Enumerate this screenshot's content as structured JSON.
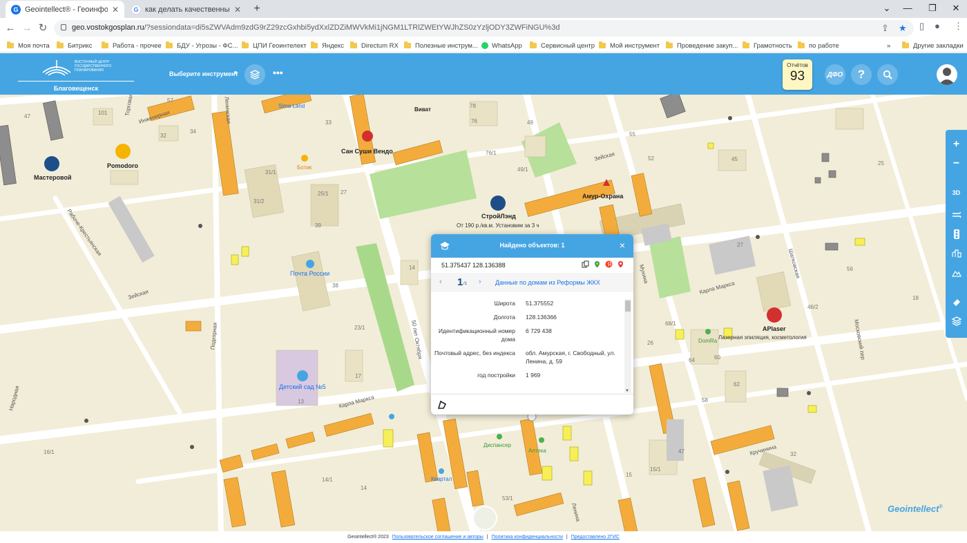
{
  "browser": {
    "tabs": [
      {
        "title": "Geointellect® - Геоинформаци",
        "active": true
      },
      {
        "title": "как делать качественные сним",
        "active": false
      }
    ],
    "new_tab": "+",
    "url_host": "geo.vostokgosplan.ru",
    "url_rest": "/?sessiondata=di5sZWVAdm9zdG9rZ29zcGxhbi5ydXxlZDZiMWVkMi1jNGM1LTRlZWEtYWJhZS0zYzljODY3ZWFiNGU%3d",
    "bookmarks": [
      "Моя почта",
      "Битрикс",
      "Работа - прочее",
      "БДУ - Угрозы - ФС...",
      "ЦПИ Геоинтелект",
      "Яндекс",
      "Directum RX",
      "Полезные инструм...",
      "WhatsApp",
      "Сервисный центр",
      "Мой инструмент",
      "Проведение закуп...",
      "Грамотность",
      "по работе"
    ],
    "other_bookmarks": "Другие закладки",
    "more_bookmarks": "»"
  },
  "app": {
    "logo_text": "ВОСТОЧНЫЙ ЦЕНТР ГОСУДАРСТВЕННОГО ПЛАНИРОВАНИЯ",
    "city": "Благовещенск",
    "tool_select": "Выберите инструмент",
    "reports_label": "Отчётов",
    "reports_count": "93",
    "dfo_label": "ДФО",
    "help_label": "?"
  },
  "map": {
    "street_labels": [
      "Инженерная",
      "Зейская",
      "Зейская",
      "Карла Маркса",
      "Карла Маркса",
      "50 лет Октября",
      "Шатковская",
      "Мухина",
      "Кручинина",
      "Подгорная",
      "Рабоче-Крестьянская",
      "Ленина",
      "Ленинская",
      "Московский пер",
      "Народная",
      "Торговая"
    ],
    "poi_labels": [
      "Sima Land",
      "Мастеровой",
      "Pomodoro",
      "Ботик",
      "Сан Суши Вендо",
      "СтройЛэнд",
      "От 190 р./кв.м. Установим за 3 ч",
      "Амур-Охрана",
      "Почта России",
      "Детский сад №5",
      "DomRa",
      "APlaser",
      "Лазерная эпиляция, косметология",
      "Диспансер",
      "Аптека",
      "Квартал",
      "Виват"
    ],
    "house_numbers": [
      "101",
      "47",
      "57",
      "32",
      "34",
      "31/1",
      "31/2",
      "39",
      "25/1",
      "27",
      "33",
      "76/1",
      "76",
      "78",
      "49/1",
      "49",
      "55",
      "52",
      "45",
      "25",
      "18",
      "14",
      "38",
      "17",
      "13",
      "23/1",
      "64",
      "60",
      "62",
      "58",
      "47",
      "15",
      "15/1",
      "32",
      "27",
      "46/2",
      "56",
      "26",
      "68/1",
      "16/1",
      "14/1",
      "14",
      "53/1"
    ],
    "watermark": "Geointellect",
    "watermark_sup": "®"
  },
  "controls": {
    "zoom_in": "+",
    "zoom_out": "−",
    "mode_3d": "3D"
  },
  "popup": {
    "title": "Найдено объектов: 1",
    "close": "×",
    "coords": "51.375437 128.136388",
    "page": "1",
    "page_of": "/1",
    "source": "Данные по домам из Реформы ЖКХ",
    "rows": [
      {
        "key": "Широта",
        "value": "51.375552"
      },
      {
        "key": "Долгота",
        "value": "128.136366"
      },
      {
        "key": "Идентификационный номер дома",
        "value": "6 729 438"
      },
      {
        "key": "Почтовый адрес, без индекса",
        "value": "обл. Амурская, г. Свободный, ул. Ленина, д. 59"
      },
      {
        "key": "год постройки",
        "value": "1 969"
      }
    ]
  },
  "footer": {
    "copyright": "Geointellect® 2023",
    "terms": "Пользовательское соглашение и авторы",
    "privacy": "Политика конфиденциальности",
    "provider": "Предоставлено 2ГИС"
  },
  "colors": {
    "header_blue": "#45a5e2",
    "map_bg": "#f2edd8",
    "building_orange": "#f3ac3c",
    "park_green": "#a8d98a"
  }
}
